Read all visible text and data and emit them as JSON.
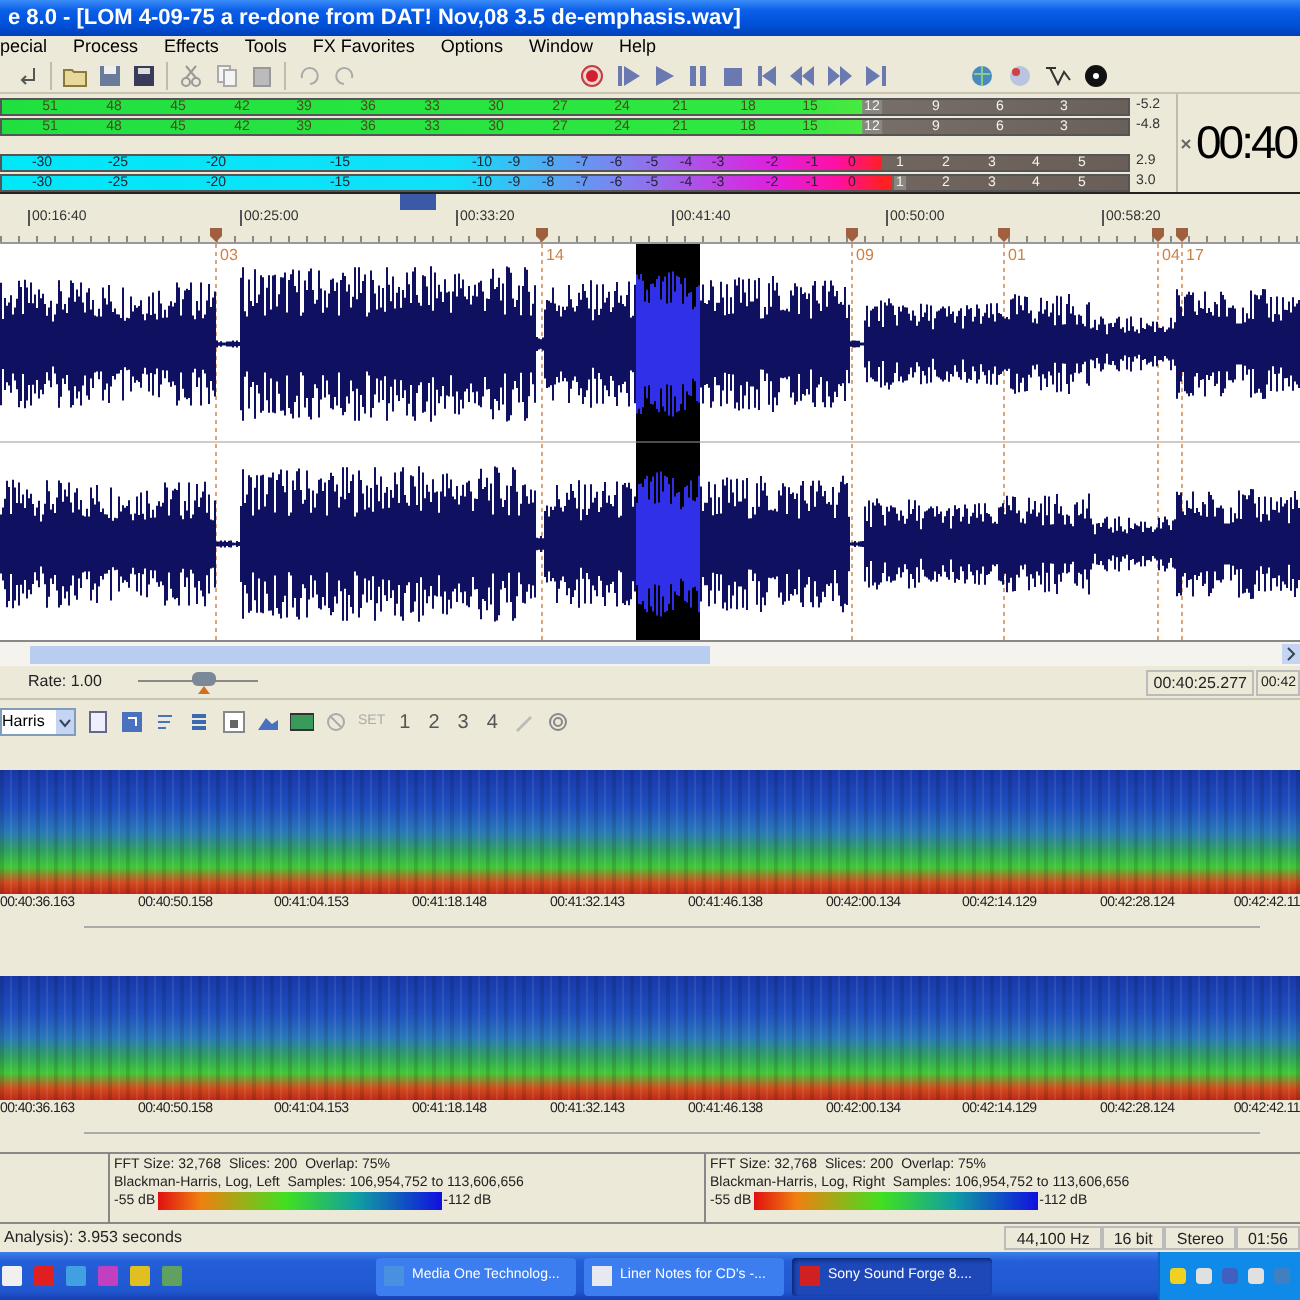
{
  "window": {
    "title": "e 8.0 - [LOM 4-09-75 a re-done from DAT! Nov,08 3.5 de-emphasis.wav]"
  },
  "menu": [
    "pecial",
    "Process",
    "Effects",
    "Tools",
    "FX Favorites",
    "Options",
    "Window",
    "Help"
  ],
  "meters": [
    {
      "kind": "peak",
      "level": 0.765,
      "reading": "-5.2",
      "ticks": [
        "51",
        "48",
        "45",
        "42",
        "39",
        "36",
        "33",
        "30",
        "27",
        "24",
        "21",
        "18",
        "15",
        "12",
        "9",
        "6",
        "3"
      ]
    },
    {
      "kind": "peak",
      "level": 0.775,
      "reading": "-4.8",
      "ticks": [
        "51",
        "48",
        "45",
        "42",
        "39",
        "36",
        "33",
        "30",
        "27",
        "24",
        "21",
        "18",
        "15",
        "12",
        "9",
        "6",
        "3"
      ]
    },
    {
      "kind": "vu",
      "level": 0.782,
      "reading": "2.9",
      "ticks": [
        "-30",
        "-25",
        "-20",
        "-15",
        "-10",
        "-9",
        "-8",
        "-7",
        "-6",
        "-5",
        "-4",
        "-3",
        "-2",
        "-1",
        "0",
        "1",
        "2",
        "3",
        "4",
        "5"
      ]
    },
    {
      "kind": "vu",
      "level": 0.791,
      "reading": "3.0",
      "ticks": [
        "-30",
        "-25",
        "-20",
        "-15",
        "-10",
        "-9",
        "-8",
        "-7",
        "-6",
        "-5",
        "-4",
        "-3",
        "-2",
        "-1",
        "0",
        "1",
        "2",
        "3",
        "4",
        "5"
      ]
    }
  ],
  "time_display": "00:40",
  "ruler": {
    "labels": [
      "00:16:40",
      "00:25:00",
      "00:33:20",
      "00:41:40",
      "00:50:00",
      "00:58:20"
    ],
    "markers": [
      {
        "label": "03"
      },
      {
        "label": "14"
      },
      {
        "label": "09"
      },
      {
        "label": "01"
      },
      {
        "label": "04"
      },
      {
        "label": "17"
      }
    ]
  },
  "transport": {
    "rate": "Rate: 1.00",
    "rate_slider": {
      "level": 0.55
    },
    "position": "00:40:25.277",
    "position_end": "00:42"
  },
  "spectrum_toolbar": {
    "window_function": "Harris",
    "set": "SET",
    "slots": [
      "1",
      "2",
      "3",
      "4"
    ]
  },
  "spectrograms": [
    {
      "times": [
        "00:40:36.163",
        "00:40:50.158",
        "00:41:04.153",
        "00:41:18.148",
        "00:41:32.143",
        "00:41:46.138",
        "00:42:00.134",
        "00:42:14.129",
        "00:42:28.124",
        "00:42:42.11"
      ]
    },
    {
      "times": [
        "00:40:36.163",
        "00:40:50.158",
        "00:41:04.153",
        "00:41:18.148",
        "00:41:32.143",
        "00:41:46.138",
        "00:42:00.134",
        "00:42:14.129",
        "00:42:28.124",
        "00:42:42.11"
      ]
    }
  ],
  "spectrum_info": [
    {
      "line1": "FFT Size: 32,768  Slices: 200  Overlap: 75%",
      "line2": "Blackman-Harris, Log, Left  Samples: 106,954,752 to 113,606,656",
      "min": "-55 dB",
      "max": "-112 dB"
    },
    {
      "line1": "FFT Size: 32,768  Slices: 200  Overlap: 75%",
      "line2": "Blackman-Harris, Log, Right  Samples: 106,954,752 to 113,606,656",
      "min": "-55 dB",
      "max": "-112 dB"
    }
  ],
  "status_bar": {
    "message": "Analysis): 3.953 seconds",
    "fields": [
      "44,100 Hz",
      "16 bit",
      "Stereo",
      "01:56"
    ]
  },
  "taskbar": {
    "tasks": [
      {
        "label": "Media One Technolog...",
        "selected": false
      },
      {
        "label": "Liner Notes for CD's -...",
        "selected": false
      },
      {
        "label": "Sony Sound Forge 8....",
        "selected": true
      }
    ]
  }
}
